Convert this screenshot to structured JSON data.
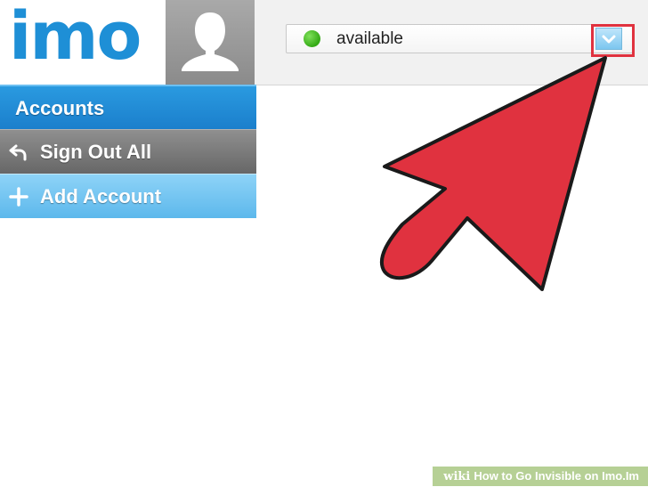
{
  "app": {
    "logo_text": "imo"
  },
  "status": {
    "label": "available",
    "dot_color": "#3bb41a"
  },
  "menu": {
    "items": [
      {
        "label": "Accounts",
        "icon": "none"
      },
      {
        "label": "Sign Out All",
        "icon": "undo-arrow-icon"
      },
      {
        "label": "Add Account",
        "icon": "plus-icon"
      }
    ]
  },
  "annotation": {
    "arrow_color": "#e0323f",
    "highlight_color": "#e0323f"
  },
  "watermark": {
    "brand": "wiki",
    "how": "How",
    "rest": " to Go Invisible on Imo.Im"
  }
}
